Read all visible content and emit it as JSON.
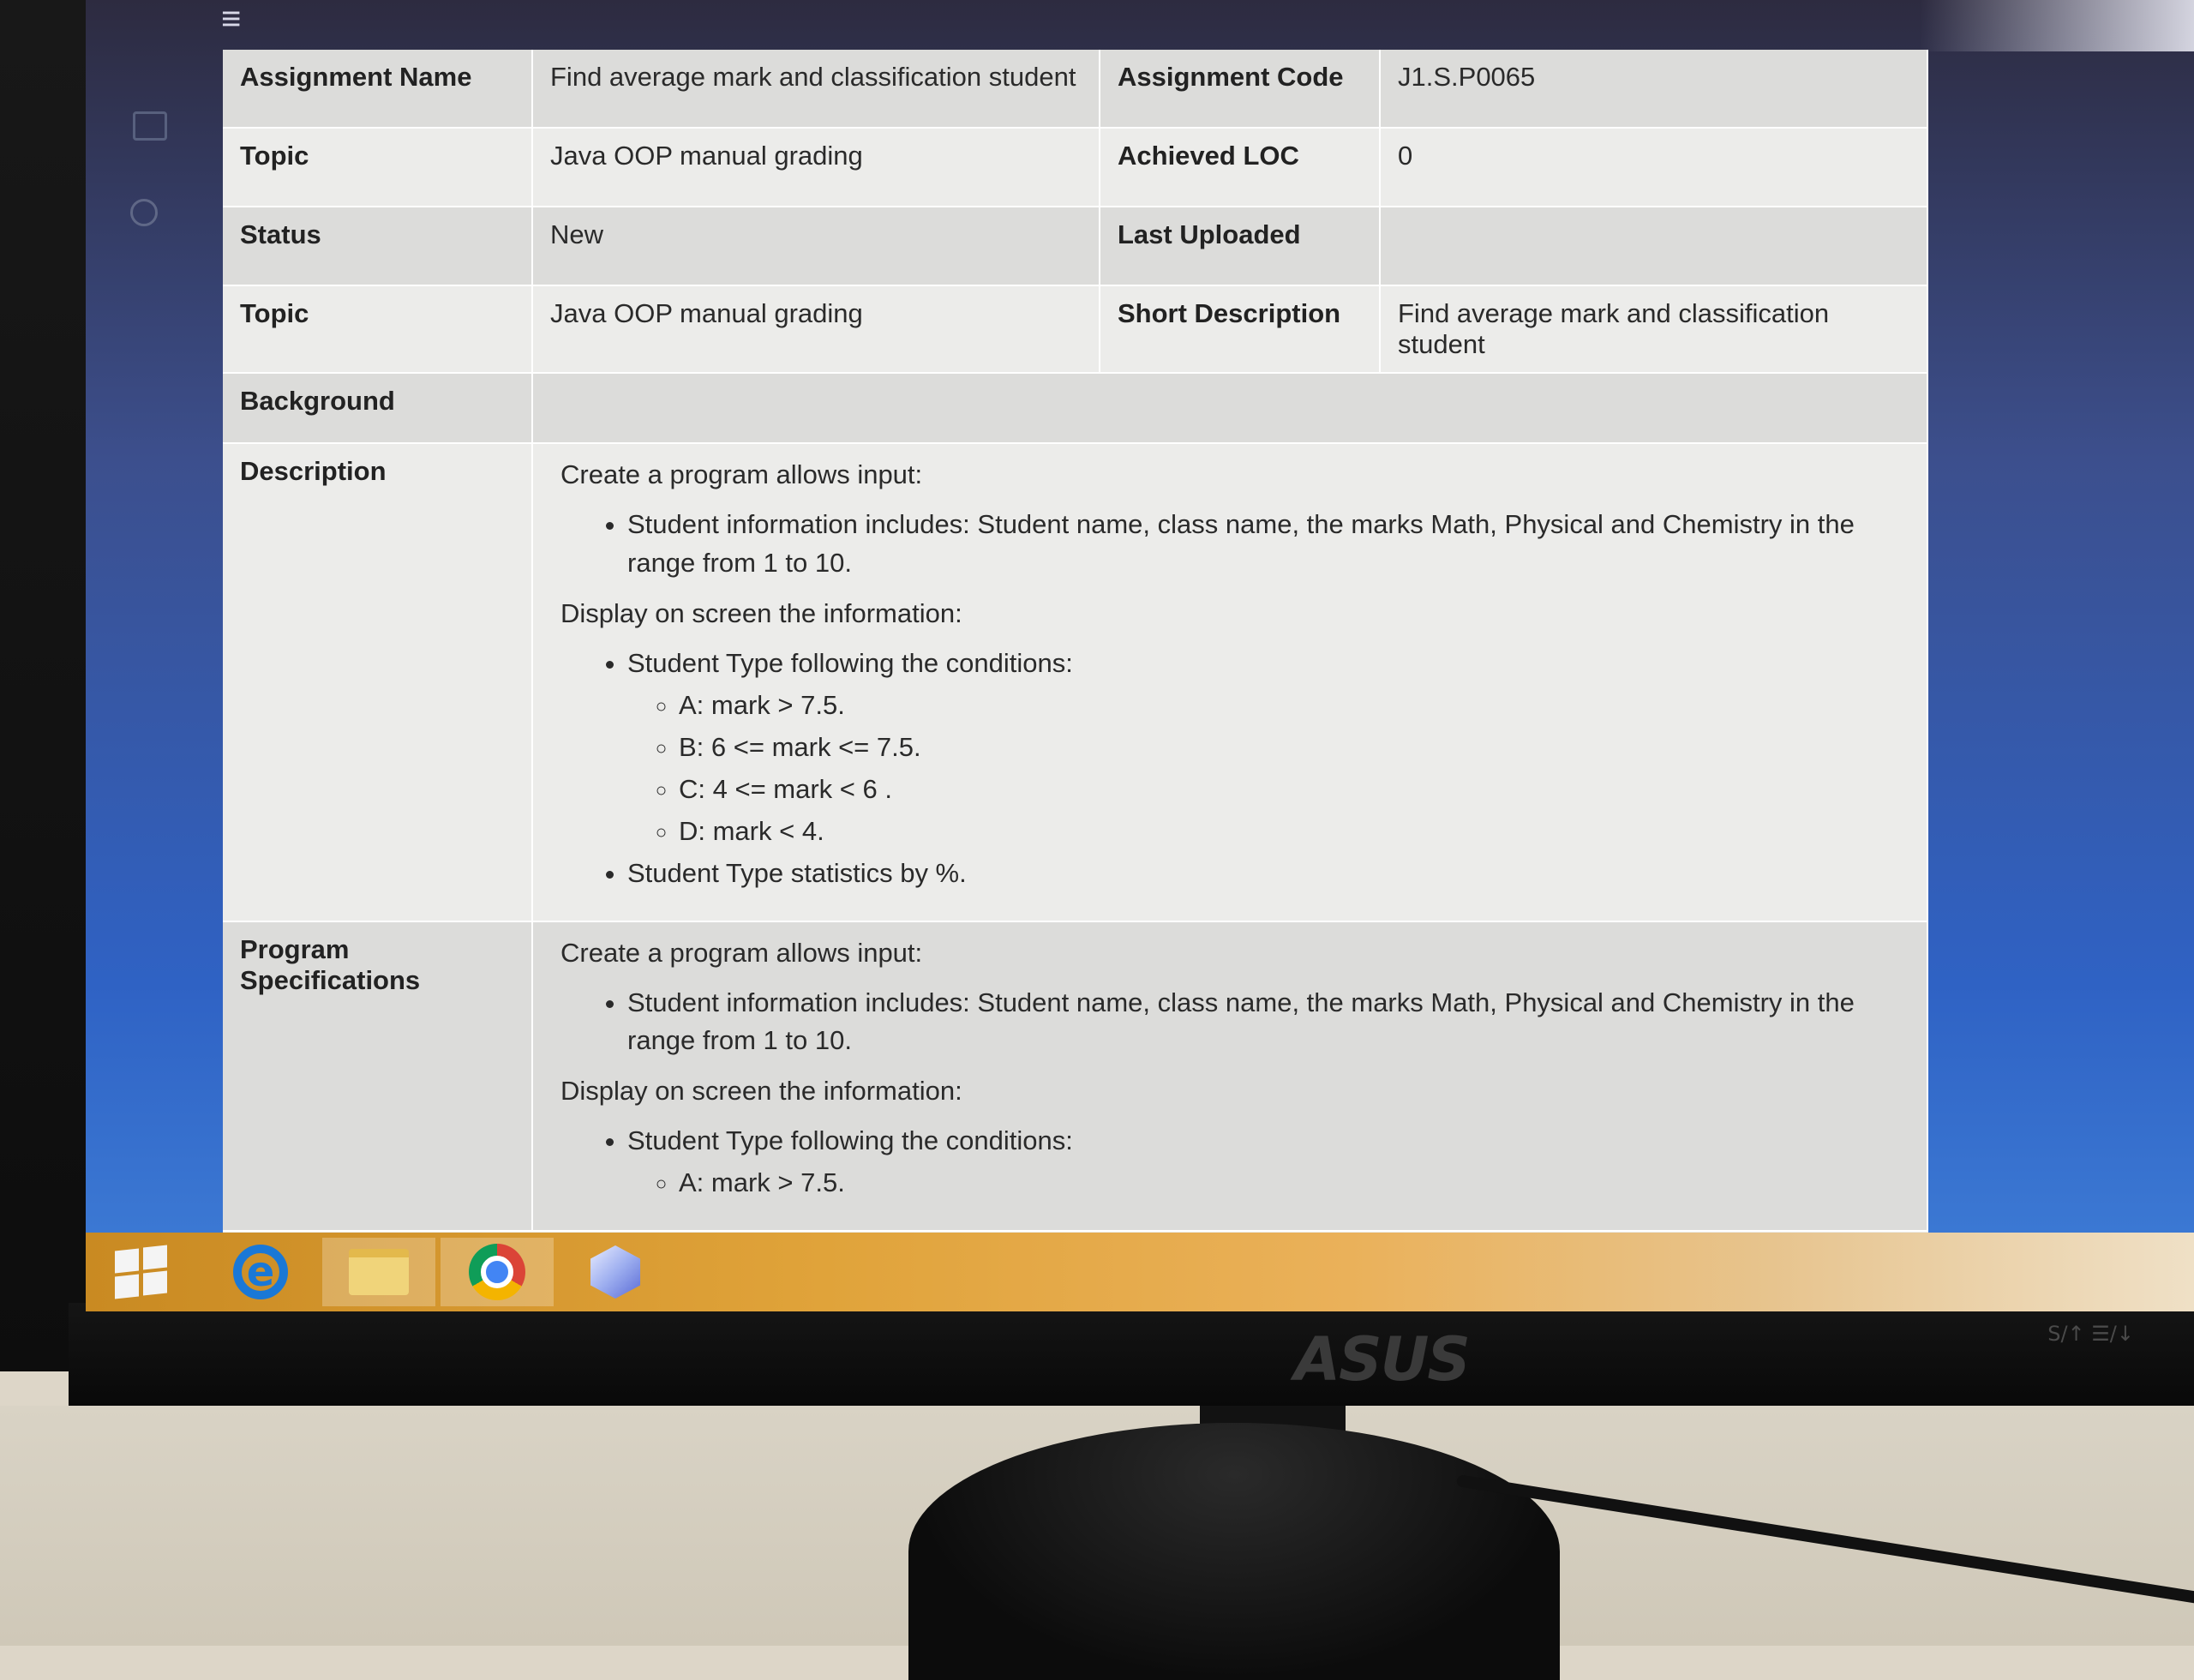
{
  "screen": {
    "menu_icon": "hamburger-icon"
  },
  "assignment": {
    "name_label": "Assignment Name",
    "name_value": "Find average mark and classification student",
    "code_label": "Assignment Code",
    "code_value": "J1.S.P0065",
    "topic_label": "Topic",
    "topic_value": "Java OOP manual grading",
    "loc_label": "Achieved LOC",
    "loc_value": "0",
    "status_label": "Status",
    "status_value": "New",
    "uploaded_label": "Last Uploaded",
    "uploaded_value": "",
    "topic2_label": "Topic",
    "topic2_value": "Java OOP manual grading",
    "short_desc_label": "Short Description",
    "short_desc_value": "Find average mark and classification student",
    "background_label": "Background",
    "background_value": ""
  },
  "description": {
    "label": "Description",
    "intro": "Create a program allows input:",
    "input_items": [
      "Student information includes: Student name, class name, the marks Math, Physical and Chemistry in the range from 1 to 10."
    ],
    "display_intro": "Display on screen the information:",
    "type_heading": "Student Type following the conditions:",
    "conditions": [
      "A: mark > 7.5.",
      "B: 6 <= mark <= 7.5.",
      "C: 4 <= mark < 6 .",
      "D: mark < 4."
    ],
    "stats": "Student Type statistics by %."
  },
  "specifications": {
    "label": "Program Specifications",
    "intro": "Create a program allows input:",
    "input_item": "Student information includes: Student name, class name, the marks Math, Physical and Chemistry in the range from 1 to 10.",
    "display_intro": "Display on screen the information:",
    "type_heading": "Student Type following the conditions:",
    "conditions": [
      "A: mark > 7.5."
    ]
  },
  "taskbar": {
    "items": [
      {
        "icon": "windows-start-icon"
      },
      {
        "icon": "internet-explorer-icon"
      },
      {
        "icon": "file-explorer-icon"
      },
      {
        "icon": "chrome-icon"
      },
      {
        "icon": "virtualbox-cube-icon"
      }
    ]
  },
  "monitor": {
    "brand": "ASUS",
    "buttons": "S/↑  ☰/↓"
  }
}
